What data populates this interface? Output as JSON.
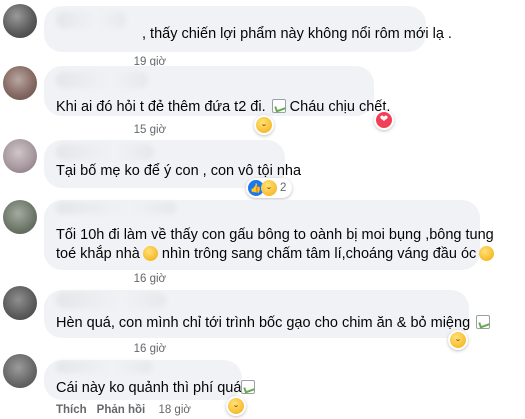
{
  "comments": [
    {
      "text": ", thấy chiến lợi phẩm này không nổi rôm mới lạ .",
      "time": "19 giờ"
    },
    {
      "text_before": "Khi ai đó hỏi t đẻ thêm đứa t2 đi.",
      "text_after": "Cháu chịu chết.",
      "time": "15 giờ",
      "reactions": [
        "haha-icon",
        "love-icon"
      ]
    },
    {
      "text": "Tại bố mẹ ko để ý con , con vô tội nha",
      "time": "16 giờ",
      "reactions": [
        "like-icon",
        "haha-icon"
      ],
      "reaction_count": "2"
    },
    {
      "line1": "Tối 10h đi làm về thấy con gấu bông to oành bị moi bụng ,bông tung",
      "line2_before": "toé khắp nhà",
      "line2_after": "nhìn trông sang chấm tâm lí,choáng váng đầu óc",
      "time": "16 giờ"
    },
    {
      "text": "Hèn quá, con mình chỉ tới trình bốc gạo cho chim ăn & bỏ miệng",
      "time": "16 giờ",
      "reactions": [
        "haha-icon"
      ]
    },
    {
      "text": "Cái này ko quảnh thì phí quá",
      "like_label": "Thích",
      "reply_label": "Phản hồi",
      "time": "18 giờ",
      "reactions": [
        "haha-icon"
      ]
    }
  ]
}
